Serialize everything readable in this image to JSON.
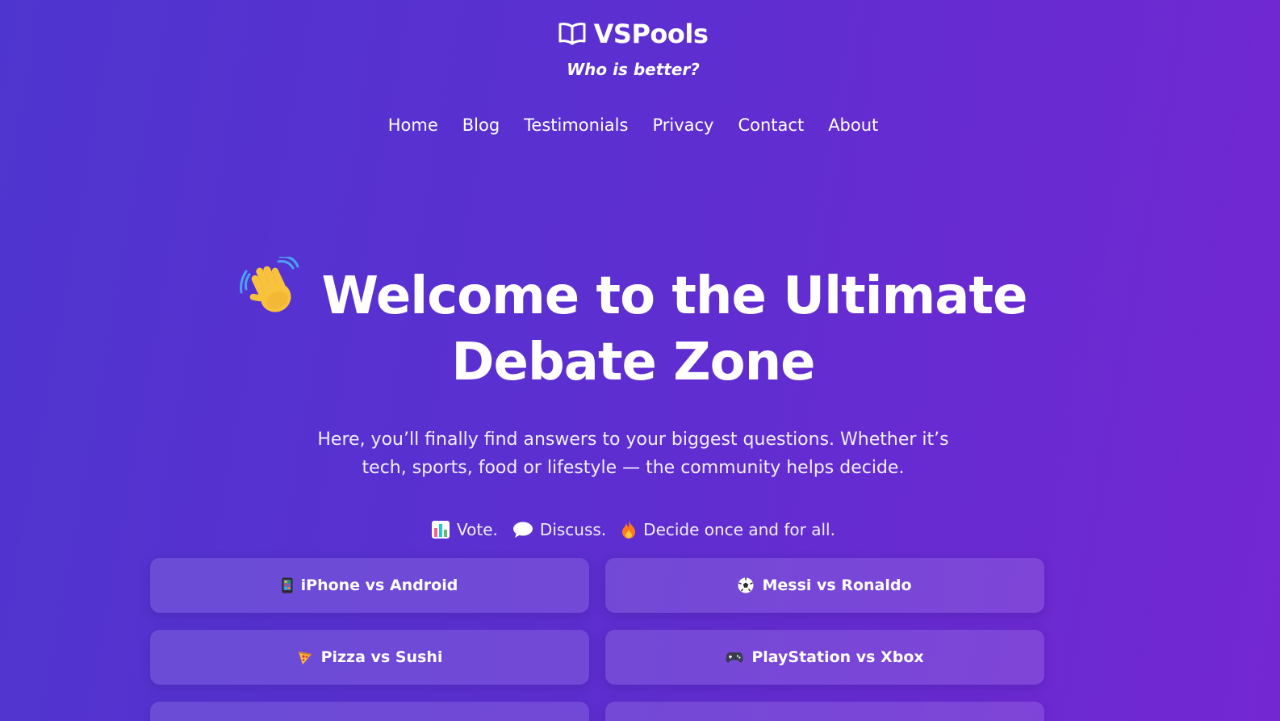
{
  "site": {
    "name": "VSPools",
    "tagline": "Who is better?",
    "logo_icon": "open-book-icon"
  },
  "nav": {
    "items": [
      {
        "label": "Home"
      },
      {
        "label": "Blog"
      },
      {
        "label": "Testimonials"
      },
      {
        "label": "Privacy"
      },
      {
        "label": "Contact"
      },
      {
        "label": "About"
      }
    ]
  },
  "hero": {
    "icon": "waving-hand-icon",
    "title_line1": "Welcome to the Ultimate",
    "title_line2": "Debate Zone",
    "description": "Here, you’ll finally find answers to your biggest questions. Whether it’s tech, sports, food or lifestyle — the community helps decide.",
    "features": [
      {
        "icon": "bar-chart-icon",
        "label": "Vote."
      },
      {
        "icon": "speech-bubble-icon",
        "label": "Discuss."
      },
      {
        "icon": "fire-icon",
        "label": "Decide once and for all."
      }
    ]
  },
  "debates": [
    {
      "icon": "smartphone-icon",
      "label": "iPhone vs Android"
    },
    {
      "icon": "soccer-ball-icon",
      "label": "Messi vs Ronaldo"
    },
    {
      "icon": "pizza-icon",
      "label": "Pizza vs Sushi"
    },
    {
      "icon": "game-controller-icon",
      "label": "PlayStation vs Xbox"
    }
  ],
  "colors": {
    "background_start": "#4f35cf",
    "background_end": "#7327d2",
    "text": "#ffffff"
  }
}
